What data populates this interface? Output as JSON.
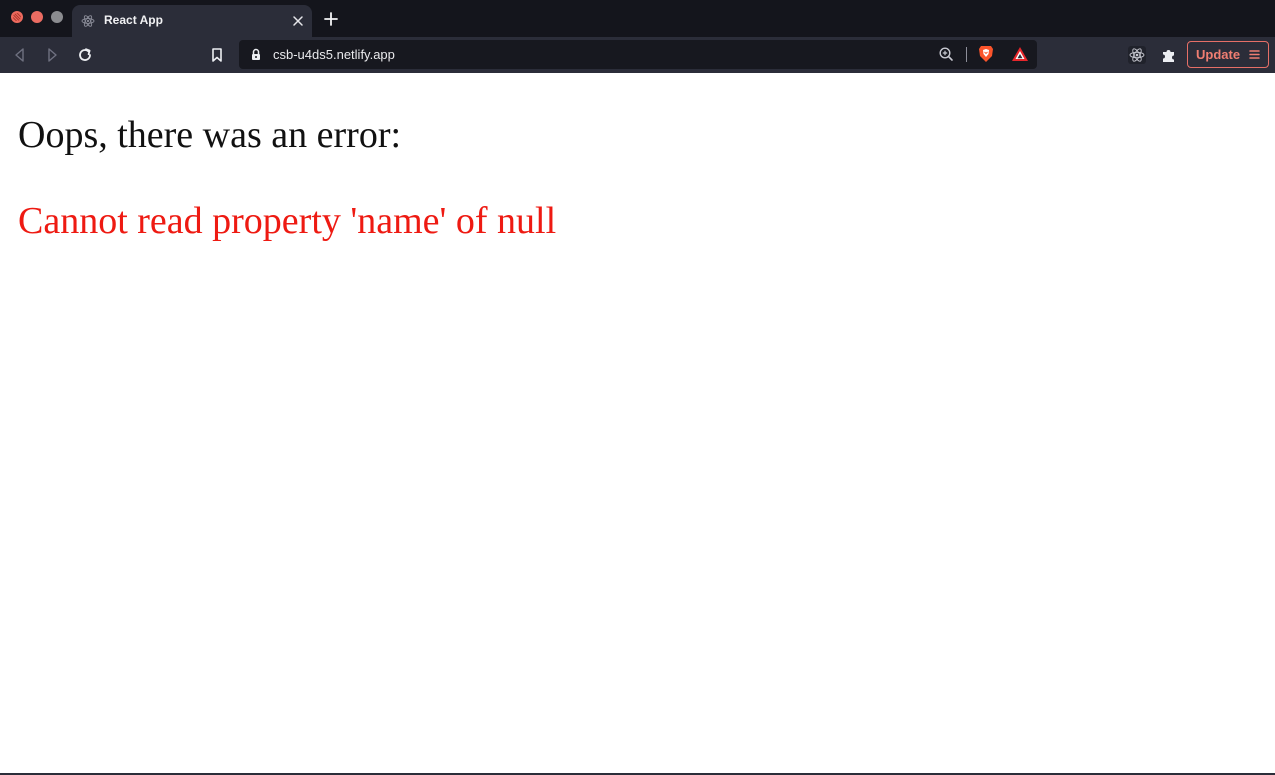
{
  "browser": {
    "window_controls": [
      "close",
      "minimize",
      "zoom"
    ],
    "tab": {
      "title": "React App",
      "favicon": "react-logo-icon"
    },
    "toolbar": {
      "address": "csb-u4ds5.netlify.app",
      "update_label": "Update",
      "icons": [
        "back-icon",
        "forward-icon",
        "reload-icon",
        "bookmark-icon",
        "lock-icon",
        "zoom-icon",
        "brave-shields-icon",
        "brave-rewards-icon",
        "react-devtools-icon",
        "extensions-icon",
        "menu-icon"
      ]
    },
    "colors": {
      "tabstrip": "#14151c",
      "toolbar": "#2b2d39",
      "addressbar": "#17181f",
      "update_accent": "#f07e72",
      "brave_orange": "#fb542b"
    }
  },
  "page": {
    "heading": "Oops, there was an error:",
    "error_message": "Cannot read property 'name' of null",
    "error_color": "#ee1a12"
  }
}
